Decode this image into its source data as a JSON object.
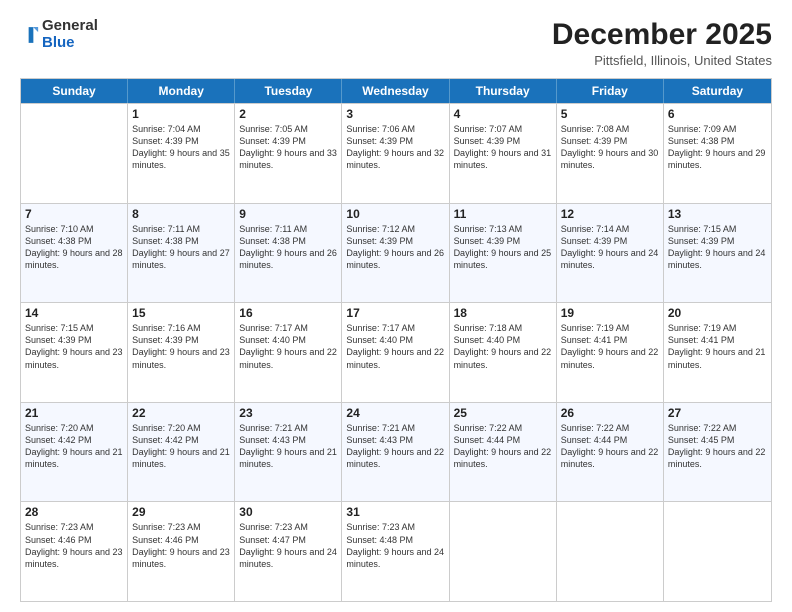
{
  "logo": {
    "general": "General",
    "blue": "Blue"
  },
  "title": {
    "main": "December 2025",
    "sub": "Pittsfield, Illinois, United States"
  },
  "calendar": {
    "days": [
      "Sunday",
      "Monday",
      "Tuesday",
      "Wednesday",
      "Thursday",
      "Friday",
      "Saturday"
    ],
    "rows": [
      [
        {
          "date": "",
          "sunrise": "",
          "sunset": "",
          "daylight": ""
        },
        {
          "date": "1",
          "sunrise": "Sunrise: 7:04 AM",
          "sunset": "Sunset: 4:39 PM",
          "daylight": "Daylight: 9 hours and 35 minutes."
        },
        {
          "date": "2",
          "sunrise": "Sunrise: 7:05 AM",
          "sunset": "Sunset: 4:39 PM",
          "daylight": "Daylight: 9 hours and 33 minutes."
        },
        {
          "date": "3",
          "sunrise": "Sunrise: 7:06 AM",
          "sunset": "Sunset: 4:39 PM",
          "daylight": "Daylight: 9 hours and 32 minutes."
        },
        {
          "date": "4",
          "sunrise": "Sunrise: 7:07 AM",
          "sunset": "Sunset: 4:39 PM",
          "daylight": "Daylight: 9 hours and 31 minutes."
        },
        {
          "date": "5",
          "sunrise": "Sunrise: 7:08 AM",
          "sunset": "Sunset: 4:39 PM",
          "daylight": "Daylight: 9 hours and 30 minutes."
        },
        {
          "date": "6",
          "sunrise": "Sunrise: 7:09 AM",
          "sunset": "Sunset: 4:38 PM",
          "daylight": "Daylight: 9 hours and 29 minutes."
        }
      ],
      [
        {
          "date": "7",
          "sunrise": "Sunrise: 7:10 AM",
          "sunset": "Sunset: 4:38 PM",
          "daylight": "Daylight: 9 hours and 28 minutes."
        },
        {
          "date": "8",
          "sunrise": "Sunrise: 7:11 AM",
          "sunset": "Sunset: 4:38 PM",
          "daylight": "Daylight: 9 hours and 27 minutes."
        },
        {
          "date": "9",
          "sunrise": "Sunrise: 7:11 AM",
          "sunset": "Sunset: 4:38 PM",
          "daylight": "Daylight: 9 hours and 26 minutes."
        },
        {
          "date": "10",
          "sunrise": "Sunrise: 7:12 AM",
          "sunset": "Sunset: 4:39 PM",
          "daylight": "Daylight: 9 hours and 26 minutes."
        },
        {
          "date": "11",
          "sunrise": "Sunrise: 7:13 AM",
          "sunset": "Sunset: 4:39 PM",
          "daylight": "Daylight: 9 hours and 25 minutes."
        },
        {
          "date": "12",
          "sunrise": "Sunrise: 7:14 AM",
          "sunset": "Sunset: 4:39 PM",
          "daylight": "Daylight: 9 hours and 24 minutes."
        },
        {
          "date": "13",
          "sunrise": "Sunrise: 7:15 AM",
          "sunset": "Sunset: 4:39 PM",
          "daylight": "Daylight: 9 hours and 24 minutes."
        }
      ],
      [
        {
          "date": "14",
          "sunrise": "Sunrise: 7:15 AM",
          "sunset": "Sunset: 4:39 PM",
          "daylight": "Daylight: 9 hours and 23 minutes."
        },
        {
          "date": "15",
          "sunrise": "Sunrise: 7:16 AM",
          "sunset": "Sunset: 4:39 PM",
          "daylight": "Daylight: 9 hours and 23 minutes."
        },
        {
          "date": "16",
          "sunrise": "Sunrise: 7:17 AM",
          "sunset": "Sunset: 4:40 PM",
          "daylight": "Daylight: 9 hours and 22 minutes."
        },
        {
          "date": "17",
          "sunrise": "Sunrise: 7:17 AM",
          "sunset": "Sunset: 4:40 PM",
          "daylight": "Daylight: 9 hours and 22 minutes."
        },
        {
          "date": "18",
          "sunrise": "Sunrise: 7:18 AM",
          "sunset": "Sunset: 4:40 PM",
          "daylight": "Daylight: 9 hours and 22 minutes."
        },
        {
          "date": "19",
          "sunrise": "Sunrise: 7:19 AM",
          "sunset": "Sunset: 4:41 PM",
          "daylight": "Daylight: 9 hours and 22 minutes."
        },
        {
          "date": "20",
          "sunrise": "Sunrise: 7:19 AM",
          "sunset": "Sunset: 4:41 PM",
          "daylight": "Daylight: 9 hours and 21 minutes."
        }
      ],
      [
        {
          "date": "21",
          "sunrise": "Sunrise: 7:20 AM",
          "sunset": "Sunset: 4:42 PM",
          "daylight": "Daylight: 9 hours and 21 minutes."
        },
        {
          "date": "22",
          "sunrise": "Sunrise: 7:20 AM",
          "sunset": "Sunset: 4:42 PM",
          "daylight": "Daylight: 9 hours and 21 minutes."
        },
        {
          "date": "23",
          "sunrise": "Sunrise: 7:21 AM",
          "sunset": "Sunset: 4:43 PM",
          "daylight": "Daylight: 9 hours and 21 minutes."
        },
        {
          "date": "24",
          "sunrise": "Sunrise: 7:21 AM",
          "sunset": "Sunset: 4:43 PM",
          "daylight": "Daylight: 9 hours and 22 minutes."
        },
        {
          "date": "25",
          "sunrise": "Sunrise: 7:22 AM",
          "sunset": "Sunset: 4:44 PM",
          "daylight": "Daylight: 9 hours and 22 minutes."
        },
        {
          "date": "26",
          "sunrise": "Sunrise: 7:22 AM",
          "sunset": "Sunset: 4:44 PM",
          "daylight": "Daylight: 9 hours and 22 minutes."
        },
        {
          "date": "27",
          "sunrise": "Sunrise: 7:22 AM",
          "sunset": "Sunset: 4:45 PM",
          "daylight": "Daylight: 9 hours and 22 minutes."
        }
      ],
      [
        {
          "date": "28",
          "sunrise": "Sunrise: 7:23 AM",
          "sunset": "Sunset: 4:46 PM",
          "daylight": "Daylight: 9 hours and 23 minutes."
        },
        {
          "date": "29",
          "sunrise": "Sunrise: 7:23 AM",
          "sunset": "Sunset: 4:46 PM",
          "daylight": "Daylight: 9 hours and 23 minutes."
        },
        {
          "date": "30",
          "sunrise": "Sunrise: 7:23 AM",
          "sunset": "Sunset: 4:47 PM",
          "daylight": "Daylight: 9 hours and 24 minutes."
        },
        {
          "date": "31",
          "sunrise": "Sunrise: 7:23 AM",
          "sunset": "Sunset: 4:48 PM",
          "daylight": "Daylight: 9 hours and 24 minutes."
        },
        {
          "date": "",
          "sunrise": "",
          "sunset": "",
          "daylight": ""
        },
        {
          "date": "",
          "sunrise": "",
          "sunset": "",
          "daylight": ""
        },
        {
          "date": "",
          "sunrise": "",
          "sunset": "",
          "daylight": ""
        }
      ]
    ]
  }
}
